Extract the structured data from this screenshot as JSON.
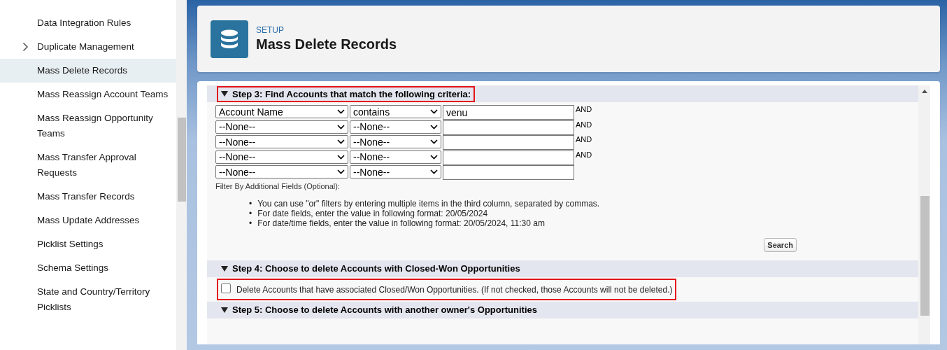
{
  "sidebar": {
    "items": [
      {
        "label": "Data Integration Rules",
        "expandable": false,
        "selected": false
      },
      {
        "label": "Duplicate Management",
        "expandable": true,
        "selected": false
      },
      {
        "label": "Mass Delete Records",
        "expandable": false,
        "selected": true
      },
      {
        "label": "Mass Reassign Account Teams",
        "expandable": false,
        "selected": false
      },
      {
        "label": "Mass Reassign Opportunity Teams",
        "expandable": false,
        "selected": false
      },
      {
        "label": "Mass Transfer Approval Requests",
        "expandable": false,
        "selected": false
      },
      {
        "label": "Mass Transfer Records",
        "expandable": false,
        "selected": false
      },
      {
        "label": "Mass Update Addresses",
        "expandable": false,
        "selected": false
      },
      {
        "label": "Picklist Settings",
        "expandable": false,
        "selected": false
      },
      {
        "label": "Schema Settings",
        "expandable": false,
        "selected": false
      },
      {
        "label": "State and Country/Territory Picklists",
        "expandable": false,
        "selected": false
      }
    ]
  },
  "header": {
    "breadcrumb": "SETUP",
    "title": "Mass Delete Records"
  },
  "steps": [
    {
      "kind": "filters",
      "title": "Step 3: Find Accounts that match the following criteria:",
      "highlighted": true,
      "rows": [
        {
          "field": "Account Name",
          "operator": "contains",
          "value": "venu",
          "connector": "AND"
        },
        {
          "field": "--None--",
          "operator": "--None--",
          "value": "",
          "connector": "AND"
        },
        {
          "field": "--None--",
          "operator": "--None--",
          "value": "",
          "connector": "AND"
        },
        {
          "field": "--None--",
          "operator": "--None--",
          "value": "",
          "connector": "AND"
        },
        {
          "field": "--None--",
          "operator": "--None--",
          "value": ""
        }
      ],
      "additional_label": "Filter By Additional Fields (Optional):",
      "tips": [
        {
          "marker": "•",
          "text": "You can use \"or\" filters by entering multiple items in the third column, separated by commas."
        },
        {
          "marker": "•",
          "text": "For date fields, enter the value in following format: 20/05/2024"
        },
        {
          "marker": "•",
          "text": "For date/time fields, enter the value in following format: 20/05/2024, 11:30 am"
        }
      ],
      "button": "Search"
    },
    {
      "kind": "checkbox",
      "title": "Step 4: Choose to delete Accounts with Closed-Won Opportunities",
      "highlighted": false,
      "checkbox": {
        "label": "Delete Accounts that have associated Closed/Won Opportunities. (If not checked, those Accounts will not be deleted.)",
        "checked": false,
        "highlighted": true
      }
    },
    {
      "kind": "header_only",
      "title": "Step 5: Choose to delete Accounts with another owner's Opportunities",
      "highlighted": false
    }
  ]
}
